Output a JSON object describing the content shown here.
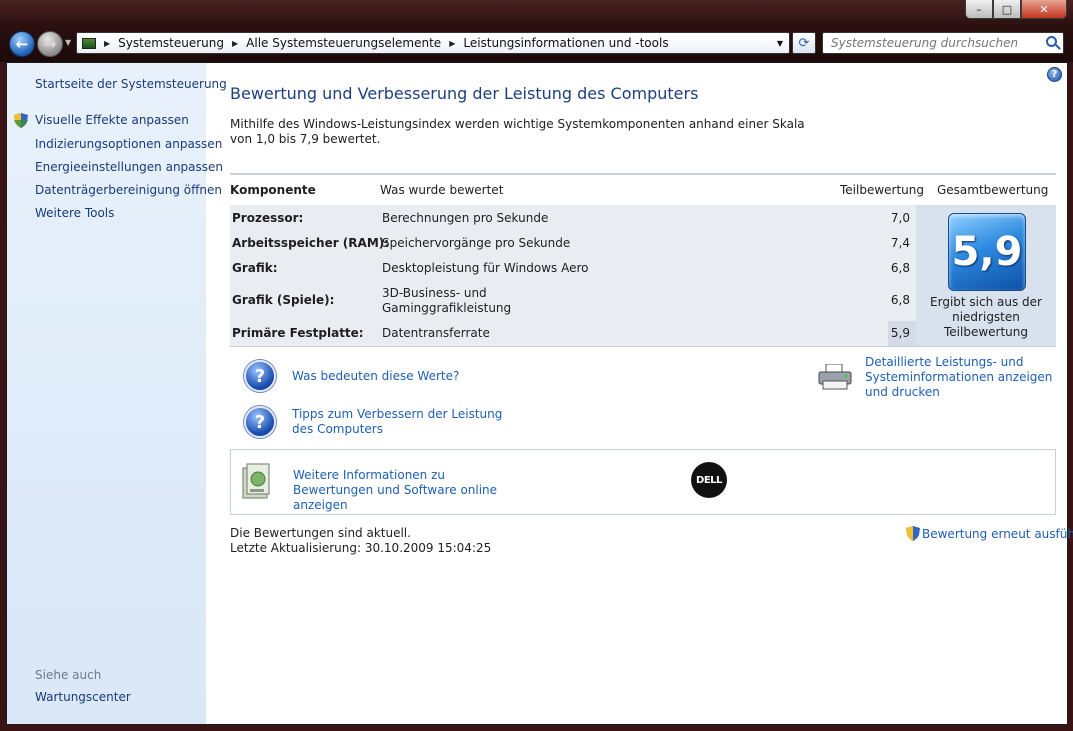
{
  "window": {
    "caption_min": "–",
    "caption_max": "□",
    "caption_close": "✕"
  },
  "addressbar": {
    "crumbs": [
      "Systemsteuerung",
      "Alle Systemsteuerungselemente",
      "Leistungsinformationen und -tools"
    ]
  },
  "search": {
    "placeholder": "Systemsteuerung durchsuchen"
  },
  "sidebar": {
    "home": "Startseite der Systemsteuerung",
    "items": [
      "Visuelle Effekte anpassen",
      "Indizierungsoptionen anpassen",
      "Energieeinstellungen anpassen",
      "Datenträgerbereinigung öffnen",
      "Weitere Tools"
    ],
    "see_also_title": "Siehe auch",
    "see_also_items": [
      "Wartungscenter"
    ]
  },
  "main": {
    "title": "Bewertung und Verbesserung der Leistung des Computers",
    "intro": "Mithilfe des Windows-Leistungsindex werden wichtige Systemkomponenten anhand einer Skala von 1,0 bis 7,9 bewertet.",
    "headers": {
      "component": "Komponente",
      "rated": "Was wurde bewertet",
      "subscore": "Teilbewertung",
      "basescore": "Gesamtbewertung"
    },
    "rows": [
      {
        "component": "Prozessor:",
        "rated": "Berechnungen pro Sekunde",
        "score": "7,0"
      },
      {
        "component": "Arbeitsspeicher (RAM):",
        "rated": "Speichervorgänge pro Sekunde",
        "score": "7,4"
      },
      {
        "component": "Grafik:",
        "rated": "Desktopleistung für Windows Aero",
        "score": "6,8"
      },
      {
        "component": "Grafik (Spiele):",
        "rated": "3D-Business- und Gaminggrafikleistung",
        "score": "6,8"
      },
      {
        "component": "Primäre Festplatte:",
        "rated": "Datentransferrate",
        "score": "5,9"
      }
    ],
    "base_score": "5,9",
    "base_score_note": "Ergibt sich aus der niedrigsten Teilbewertung",
    "links": {
      "what_mean": "Was bedeuten diese Werte?",
      "tips": "Tipps zum Verbessern der Leistung des Computers",
      "details": "Detaillierte Leistungs- und Systeminformationen anzeigen und drucken",
      "more_info": "Weitere Informationen zu Bewertungen und Software online anzeigen"
    },
    "oem_logo": "DELL",
    "status": "Die Bewertungen sind aktuell.",
    "last_update": "Letzte Aktualisierung: 30.10.2009 15:04:25",
    "rerun": "Bewertung erneut ausführen"
  }
}
